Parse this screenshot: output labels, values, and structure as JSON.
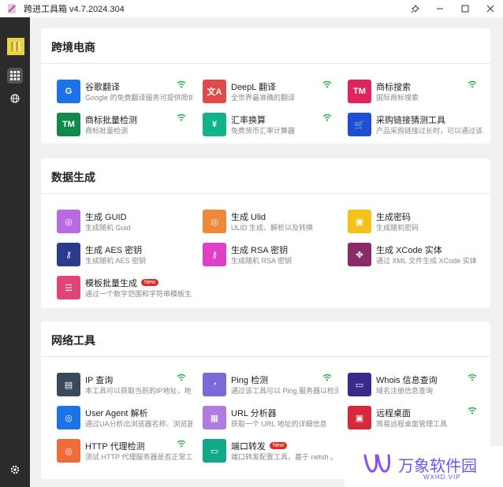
{
  "window": {
    "title": "跨进工具箱 v4.7.2024.304"
  },
  "sections": [
    {
      "title": "跨境电商",
      "tools": [
        {
          "name": "谷歌翻译",
          "desc": "Google 的免费翻译服务可提供简体",
          "icon": "translate-icon",
          "color": "#1a73e8",
          "glyph": "G",
          "online": true
        },
        {
          "name": "DeepL 翻译",
          "desc": "全世界最准确的翻译",
          "icon": "translate-icon",
          "color": "#e04a4a",
          "glyph": "文A",
          "online": true
        },
        {
          "name": "商标搜索",
          "desc": "国际商标搜索",
          "icon": "tm-icon",
          "color": "#e0245e",
          "glyph": "TM",
          "online": true
        },
        {
          "name": "商标批量检测",
          "desc": "商标批量检测",
          "icon": "tm-icon",
          "color": "#0f8a4a",
          "glyph": "TM",
          "online": true
        },
        {
          "name": "汇率换算",
          "desc": "免费货币汇率计算器",
          "icon": "yen-icon",
          "color": "#11b38a",
          "glyph": "¥",
          "online": true
        },
        {
          "name": "采购链接猜测工具",
          "desc": "产品采购链接过长时，可以通过该工",
          "icon": "cart-icon",
          "color": "#1d4fd6",
          "glyph": "🛒",
          "online": false
        }
      ]
    },
    {
      "title": "数据生成",
      "tools": [
        {
          "name": "生成 GUID",
          "desc": "生成随机 Guid",
          "icon": "globe-icon",
          "color": "#b86be0",
          "glyph": "◎",
          "online": false
        },
        {
          "name": "生成 Ulid",
          "desc": "ULID 生成、解析以及转换",
          "icon": "globe-icon",
          "color": "#f0883a",
          "glyph": "◎",
          "online": false
        },
        {
          "name": "生成密码",
          "desc": "生成随机密码",
          "icon": "password-icon",
          "color": "#f2c21a",
          "glyph": "▣",
          "online": false
        },
        {
          "name": "生成 AES 密钥",
          "desc": "生成随机 AES 密钥",
          "icon": "key-icon",
          "color": "#2b3a8c",
          "glyph": "⚷",
          "online": false
        },
        {
          "name": "生成 RSA 密钥",
          "desc": "生成随机 RSA 密钥",
          "icon": "key-plus-icon",
          "color": "#e040c8",
          "glyph": "⚷",
          "online": false
        },
        {
          "name": "生成 XCode 实体",
          "desc": "通过 XML 文件生成 XCode 实体",
          "icon": "puzzle-icon",
          "color": "#8a2a6a",
          "glyph": "✤",
          "online": false
        },
        {
          "name": "模板批量生成",
          "desc": "通过一个数字范围和字符串模板生成",
          "icon": "template-icon",
          "color": "#e0457a",
          "glyph": "☰",
          "online": false,
          "badge": "New"
        }
      ]
    },
    {
      "title": "网络工具",
      "tools": [
        {
          "name": "IP 查询",
          "desc": "本工具可以获取当前的IP地址，地",
          "icon": "ip-icon",
          "color": "#3a4a5a",
          "glyph": "▤",
          "online": true
        },
        {
          "name": "Ping 检测",
          "desc": "通过该工具可以 Ping 服务器以检测",
          "icon": "gauge-icon",
          "color": "#7a6ad8",
          "glyph": "◔",
          "online": true
        },
        {
          "name": "Whois 信息查询",
          "desc": "域名注册信息查询",
          "icon": "id-card-icon",
          "color": "#3a2a8c",
          "glyph": "▭",
          "online": true
        },
        {
          "name": "User Agent 解析",
          "desc": "通过UA分析出浏览器名称、浏览器",
          "icon": "globe-icon",
          "color": "#1a73e8",
          "glyph": "◎",
          "online": false
        },
        {
          "name": "URL 分析器",
          "desc": "获取一个 URL 地址的详细信息",
          "icon": "url-icon",
          "color": "#b07ae0",
          "glyph": "▦",
          "online": false
        },
        {
          "name": "远程桌面",
          "desc": "简易远程桌面管理工具",
          "icon": "remote-desktop-icon",
          "color": "#d8283a",
          "glyph": "▣",
          "online": true
        },
        {
          "name": "HTTP 代理检测",
          "desc": "测试 HTTP 代理服务器是否正常工作",
          "icon": "globe-icon",
          "color": "#f06a3a",
          "glyph": "◎",
          "online": true
        },
        {
          "name": "端口转发",
          "desc": "端口转发配置工具，基于 netsh 。",
          "icon": "port-icon",
          "color": "#12a88a",
          "glyph": "▭",
          "online": false,
          "badge": "New"
        }
      ]
    }
  ],
  "watermark": {
    "text": "万象软件园",
    "sub": "WXHD.VIP"
  }
}
